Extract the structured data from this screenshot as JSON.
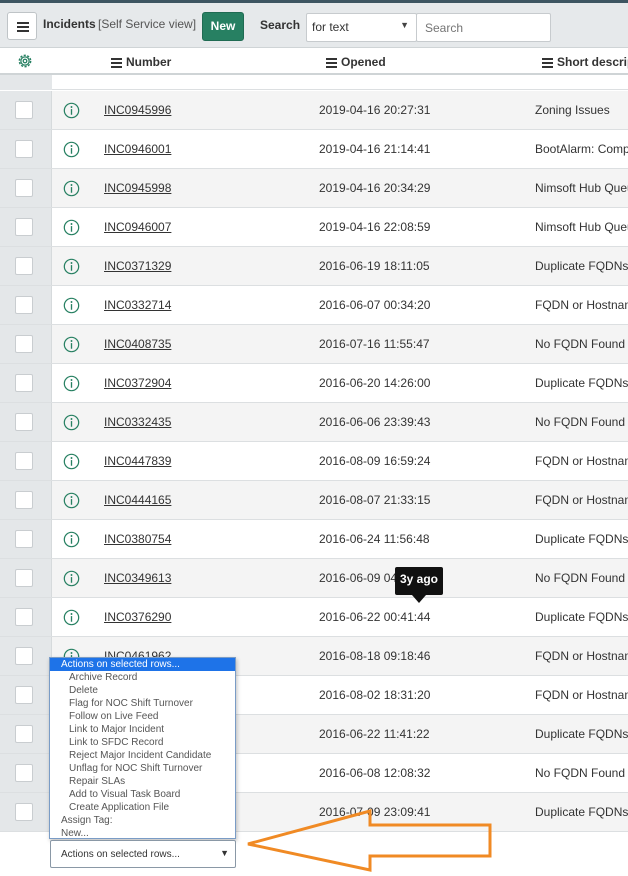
{
  "header": {
    "title": "Incidents",
    "view": "[Self Service view]",
    "new_label": "New",
    "search_label": "Search",
    "search_field": "for text",
    "search_placeholder": "Search"
  },
  "columns": {
    "number": "Number",
    "opened": "Opened",
    "short_description": "Short descrip"
  },
  "rows": [
    {
      "number": "INC0945996",
      "opened": "2019-04-16 20:27:31",
      "desc": "Zoning Issues"
    },
    {
      "number": "INC0946001",
      "opened": "2019-04-16 21:14:41",
      "desc": "BootAlarm: Comp"
    },
    {
      "number": "INC0945998",
      "opened": "2019-04-16 20:34:29",
      "desc": "Nimsoft Hub Queu"
    },
    {
      "number": "INC0946007",
      "opened": "2019-04-16 22:08:59",
      "desc": "Nimsoft Hub Queu"
    },
    {
      "number": "INC0371329",
      "opened": "2016-06-19 18:11:05",
      "desc": "Duplicate FQDNs"
    },
    {
      "number": "INC0332714",
      "opened": "2016-06-07 00:34:20",
      "desc": "FQDN or Hostnam"
    },
    {
      "number": "INC0408735",
      "opened": "2016-07-16 11:55:47",
      "desc": "No FQDN Found -"
    },
    {
      "number": "INC0372904",
      "opened": "2016-06-20 14:26:00",
      "desc": "Duplicate FQDNs"
    },
    {
      "number": "INC0332435",
      "opened": "2016-06-06 23:39:43",
      "desc": "No FQDN Found -"
    },
    {
      "number": "INC0447839",
      "opened": "2016-08-09 16:59:24",
      "desc": "FQDN or Hostnam"
    },
    {
      "number": "INC0444165",
      "opened": "2016-08-07 21:33:15",
      "desc": "FQDN or Hostnam"
    },
    {
      "number": "INC0380754",
      "opened": "2016-06-24 11:56:48",
      "desc": "Duplicate FQDNs"
    },
    {
      "number": "INC0349613",
      "opened": "2016-06-09 04",
      "desc": "No FQDN Found -"
    },
    {
      "number": "INC0376290",
      "opened": "2016-06-22 00:41:44",
      "desc": "Duplicate FQDNs"
    },
    {
      "number": "INC0461962",
      "opened": "2016-08-18 09:18:46",
      "desc": "FQDN or Hostnam"
    },
    {
      "number": "",
      "opened": "2016-08-02 18:31:20",
      "desc": "FQDN or Hostnam"
    },
    {
      "number": "",
      "opened": "2016-06-22 11:41:22",
      "desc": "Duplicate FQDNs"
    },
    {
      "number": "",
      "opened": "2016-06-08 12:08:32",
      "desc": "No FQDN Found -"
    },
    {
      "number": "",
      "opened": "2016-07-09 23:09:41",
      "desc": "Duplicate FQDNs"
    }
  ],
  "tooltip": "3y ago",
  "actions": {
    "selected": "Actions on selected rows...",
    "options": [
      "Archive Record",
      "Delete",
      "Flag for NOC Shift Turnover",
      "Follow on Live Feed",
      "Link to Major Incident",
      "Link to SFDC Record",
      "Reject Major Incident Candidate",
      "Unflag for NOC Shift Turnover",
      "Repair SLAs",
      "Add to Visual Task Board",
      "Create Application File"
    ],
    "assign_tag": "Assign Tag:",
    "new_tag": "New..."
  },
  "colors": {
    "accent": "#278062",
    "annotation_arrow": "#f08a24",
    "dropdown_highlight": "#1e73e8"
  }
}
